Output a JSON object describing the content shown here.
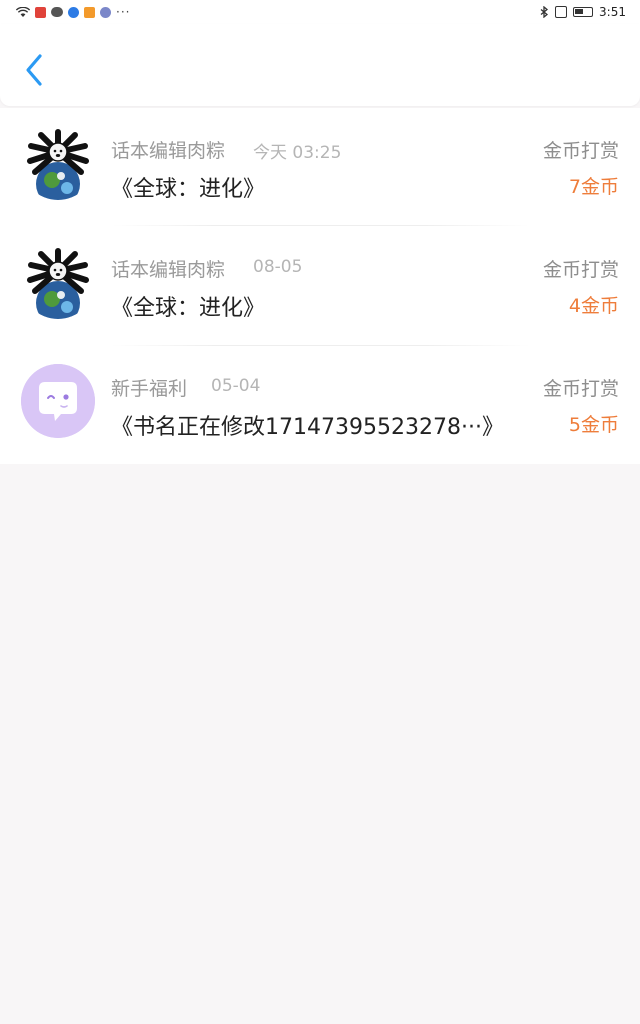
{
  "status_bar": {
    "time": "3:51",
    "more": "···",
    "icons": [
      "wifi-icon",
      "app-red-icon",
      "wechat-icon",
      "app-blue-icon",
      "app-orange-icon",
      "app-purple-icon",
      "bluetooth-icon",
      "vibrate-icon",
      "battery-icon"
    ]
  },
  "header": {
    "back_icon": "chevron-left-icon",
    "accent_color": "#2b9af3"
  },
  "colors": {
    "amount": "#ee7d3b",
    "sender": "#9a9a9a",
    "title": "#222222"
  },
  "records": [
    {
      "avatar": "globe-meme-avatar",
      "sender": "话本编辑肉粽",
      "time": "今天 03:25",
      "book": "《全球：进化》",
      "type": "金币打赏",
      "amount": "7金币"
    },
    {
      "avatar": "globe-meme-avatar",
      "sender": "话本编辑肉粽",
      "time": "08-05",
      "book": "《全球：进化》",
      "type": "金币打赏",
      "amount": "4金币"
    },
    {
      "avatar": "chat-bubble-avatar",
      "sender": "新手福利",
      "time": "05-04",
      "book": "《书名正在修改17147395523278···》",
      "type": "金币打赏",
      "amount": "5金币"
    }
  ]
}
